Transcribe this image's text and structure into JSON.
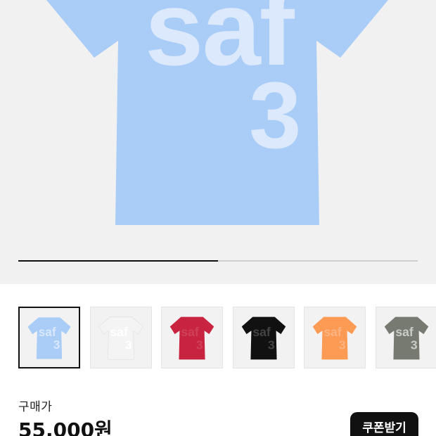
{
  "hero": {
    "print_text": "saf",
    "print_number": "3",
    "shirt_color": "#aacdf7",
    "print_color": "#dce8fb",
    "background": "#f1f1f1",
    "slide_progress": 0.5
  },
  "thumbnails": [
    {
      "color": "#a9cdf6",
      "print_color": "#d9e7fb",
      "selected": true
    },
    {
      "color": "#f4f4f4",
      "print_color": "#ffffff",
      "selected": false
    },
    {
      "color": "#c8243f",
      "print_color": "#cf4058",
      "selected": false
    },
    {
      "color": "#111111",
      "print_color": "#444444",
      "selected": false
    },
    {
      "color": "#fd9b55",
      "print_color": "#fbb382",
      "selected": false
    },
    {
      "color": "#767a70",
      "print_color": "#c9ccc4",
      "selected": false
    }
  ],
  "price": {
    "label": "구매가",
    "value": "55,000원"
  },
  "coupon_button": {
    "label": "쿠폰받기"
  }
}
